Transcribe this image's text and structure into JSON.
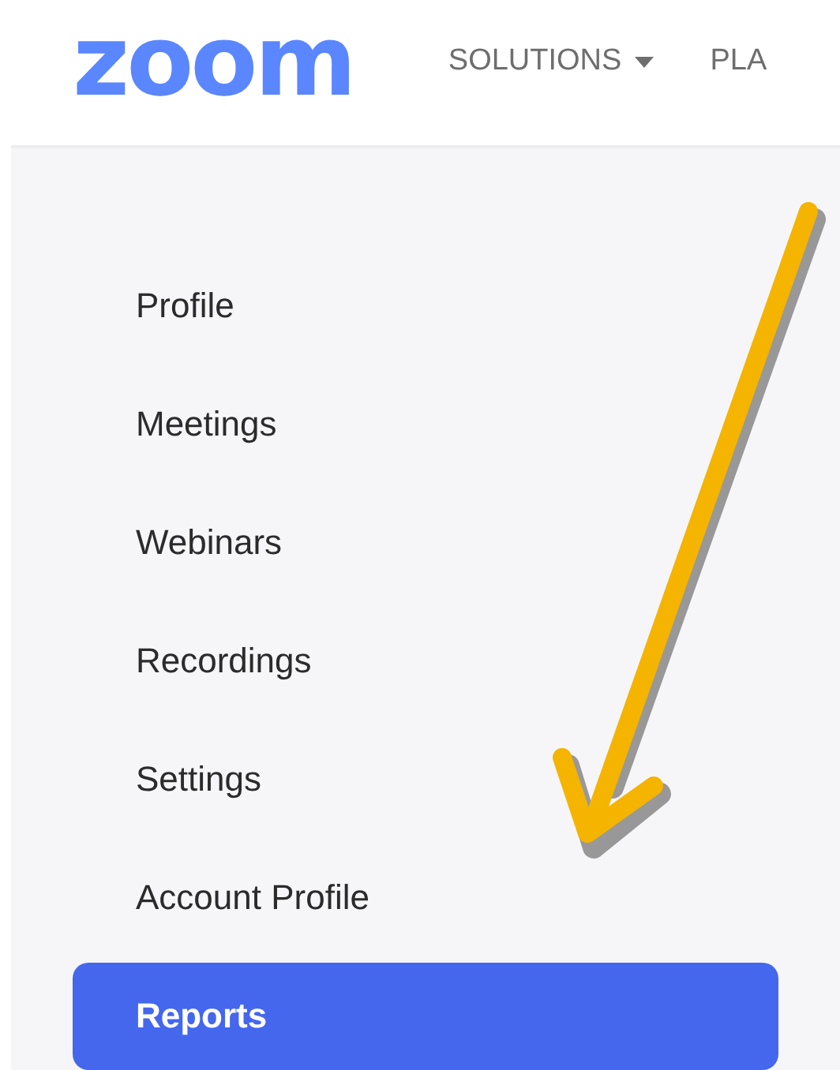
{
  "header": {
    "logo": "zoom",
    "nav": [
      {
        "label": "SOLUTIONS",
        "dropdown": true
      },
      {
        "label": "PLA",
        "dropdown": false
      }
    ]
  },
  "sidebar": {
    "items": [
      {
        "label": "Profile",
        "selected": false
      },
      {
        "label": "Meetings",
        "selected": false
      },
      {
        "label": "Webinars",
        "selected": false
      },
      {
        "label": "Recordings",
        "selected": false
      },
      {
        "label": "Settings",
        "selected": false
      },
      {
        "label": "Account Profile",
        "selected": false
      },
      {
        "label": "Reports",
        "selected": true
      }
    ]
  }
}
